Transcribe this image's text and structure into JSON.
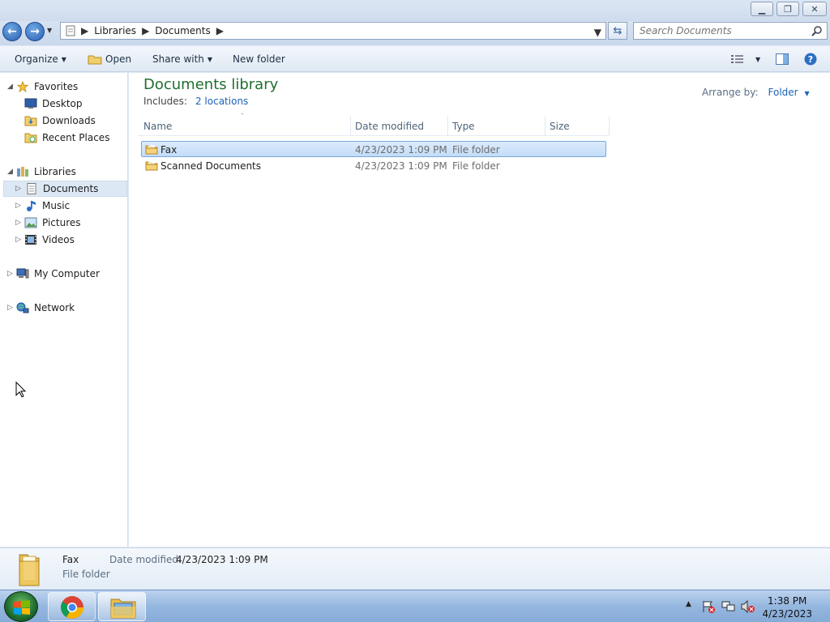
{
  "window": {
    "minimize_icon": "minimize-icon",
    "maximize_icon": "restore-icon",
    "close_icon": "close-icon"
  },
  "address": {
    "crumbs": [
      "Libraries",
      "Documents"
    ],
    "search_placeholder": "Search Documents"
  },
  "toolbar": {
    "organize": "Organize",
    "open": "Open",
    "share_with": "Share with",
    "new_folder": "New folder"
  },
  "sidebar": {
    "favorites": {
      "label": "Favorites",
      "items": [
        "Desktop",
        "Downloads",
        "Recent Places"
      ]
    },
    "libraries": {
      "label": "Libraries",
      "items": [
        "Documents",
        "Music",
        "Pictures",
        "Videos"
      ],
      "selected": "Documents"
    },
    "computer": "My Computer",
    "network": "Network"
  },
  "library": {
    "title": "Documents library",
    "includes_label": "Includes:",
    "includes_link": "2 locations",
    "arrange_label": "Arrange by:",
    "arrange_value": "Folder"
  },
  "columns": [
    "Name",
    "Date modified",
    "Type",
    "Size"
  ],
  "files": [
    {
      "name": "Fax",
      "date": "4/23/2023 1:09 PM",
      "type": "File folder",
      "size": "",
      "selected": true
    },
    {
      "name": "Scanned Documents",
      "date": "4/23/2023 1:09 PM",
      "type": "File folder",
      "size": "",
      "selected": false
    }
  ],
  "details": {
    "name": "Fax",
    "date_label": "Date modified:",
    "date_value": "4/23/2023 1:09 PM",
    "type": "File folder"
  },
  "taskbar": {
    "time": "1:38 PM",
    "date": "4/23/2023"
  },
  "colors": {
    "accent": "#1c63b7",
    "title_green": "#1e6f30",
    "selection": "#c3dcf8"
  }
}
